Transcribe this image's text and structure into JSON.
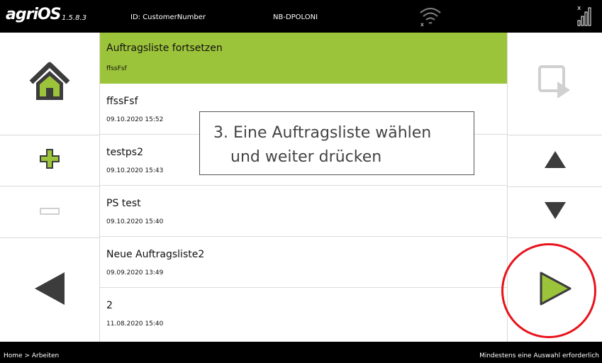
{
  "header": {
    "logo": "agriOS",
    "version": "1.5.8.3",
    "customer_id": "ID: CustomerNumber",
    "device": "NB-DPOLONI"
  },
  "list": {
    "items": [
      {
        "name": "Auftragsliste fortsetzen",
        "date": "ffssFsf",
        "selected": true
      },
      {
        "name": "ffssFsf",
        "date": "09.10.2020 15:52",
        "selected": false
      },
      {
        "name": "testps2",
        "date": "09.10.2020 15:43",
        "selected": false
      },
      {
        "name": "PS test",
        "date": "09.10.2020 15:40",
        "selected": false
      },
      {
        "name": "Neue Auftragsliste2",
        "date": "09.09.2020 13:49",
        "selected": false
      },
      {
        "name": "2",
        "date": "11.08.2020 15:40",
        "selected": false
      }
    ]
  },
  "callout": {
    "line1": "3. Eine Auftragsliste wählen",
    "line2": "und weiter drücken"
  },
  "footer": {
    "breadcrumb": "Home > Arbeiten",
    "status": "Mindestens eine Auswahl erforderlich"
  },
  "colors": {
    "accent": "#9cc43a",
    "icon_dark": "#3c3c3c",
    "icon_disabled": "#d0d0d0",
    "highlight": "#e8121b"
  }
}
